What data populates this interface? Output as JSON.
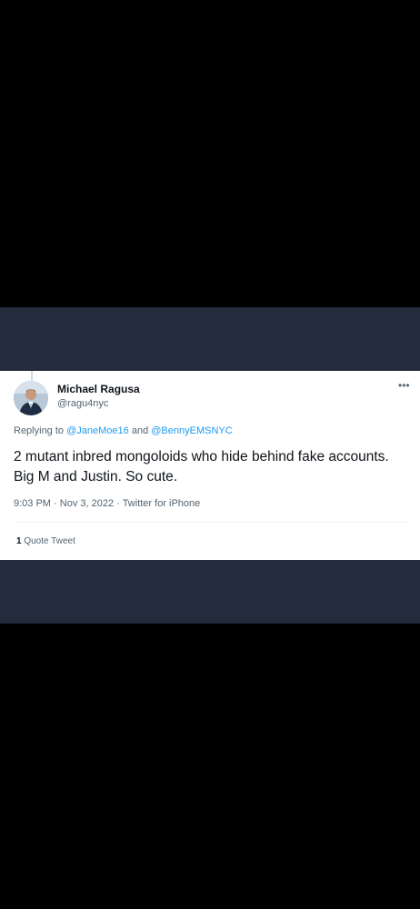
{
  "tweet": {
    "author_name": "Michael Ragusa",
    "author_handle": "@ragu4nyc",
    "reply_prefix": "Replying to",
    "reply_mention_1": "@JaneMoe16",
    "reply_and": "and",
    "reply_mention_2": "@BennyEMSNYC",
    "text": "2 mutant inbred mongoloids who hide behind fake accounts. Big M and Justin. So cute.",
    "time": "9:03 PM",
    "date": "Nov 3, 2022",
    "separator": "·",
    "source": "Twitter for iPhone",
    "quote_count": "1",
    "quote_label": "Quote Tweet"
  },
  "icons": {
    "more": "more-horizontal-icon",
    "avatar": "profile-photo"
  },
  "colors": {
    "page_background": "#000000",
    "band_background": "#232c3d",
    "card_background": "#ffffff",
    "primary_text": "#0f1419",
    "secondary_text": "#536471",
    "link": "#1d9bf0"
  }
}
